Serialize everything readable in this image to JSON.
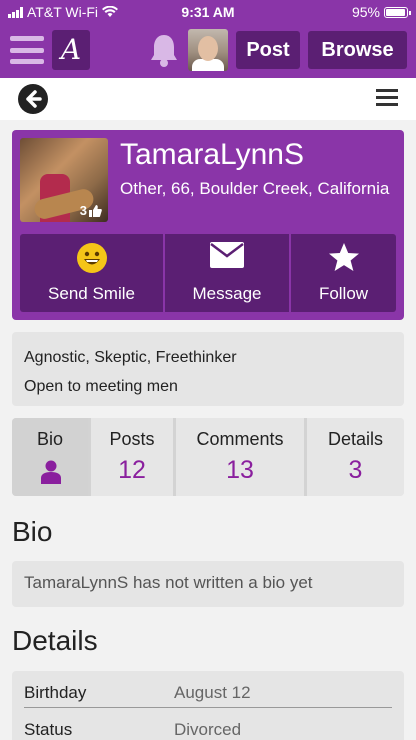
{
  "status_bar": {
    "carrier": "AT&T Wi-Fi",
    "time": "9:31 AM",
    "battery": "95%",
    "battery_level": 0.95
  },
  "navbar": {
    "logo_letter": "A",
    "post_label": "Post",
    "browse_label": "Browse"
  },
  "profile": {
    "username": "TamaraLynnS",
    "location": "Other, 66, Boulder Creek, California",
    "likes": "3",
    "actions": {
      "smile": "Send Smile",
      "message": "Message",
      "follow": "Follow"
    }
  },
  "about": {
    "beliefs": "Agnostic, Skeptic, Freethinker",
    "seeking": "Open to meeting men"
  },
  "tabs": {
    "bio": {
      "label": "Bio"
    },
    "posts": {
      "label": "Posts",
      "count": "12"
    },
    "comments": {
      "label": "Comments",
      "count": "13"
    },
    "details": {
      "label": "Details",
      "count": "3"
    }
  },
  "bio_section": {
    "title": "Bio",
    "text": "TamaraLynnS has not written a bio yet"
  },
  "details_section": {
    "title": "Details",
    "rows": [
      {
        "key": "Birthday",
        "value": "August 12"
      },
      {
        "key": "Status",
        "value": "Divorced"
      }
    ]
  },
  "colors": {
    "brand": "#8a35a8",
    "brand_dark": "#5b1f73",
    "accent": "#8a1f9e"
  }
}
